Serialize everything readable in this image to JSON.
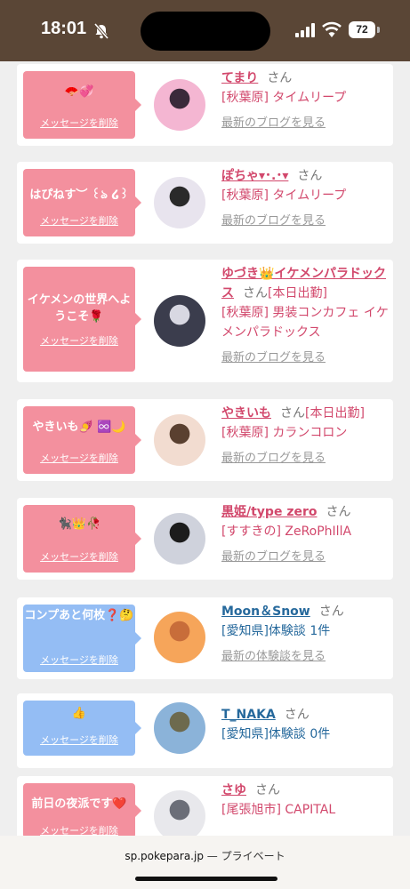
{
  "status_bar": {
    "time": "18:01",
    "battery": "72"
  },
  "cards": [
    {
      "theme": "pink",
      "message": "🪭💞",
      "delete_label": "メッセージを削除",
      "name": "てまり",
      "suffix": "さん",
      "status": "",
      "shop": "[秋葉原] タイムリープ",
      "link": "最新のブログを見る",
      "avatar_colors": [
        "#f4b6d2",
        "#3a2a3a"
      ]
    },
    {
      "theme": "pink",
      "message": "はぴねす︶ ꒰ঌ ໒꒱",
      "delete_label": "メッセージを削除",
      "name": "ぽちゃ▾･.･▾",
      "suffix": "さん",
      "status": "",
      "shop": "[秋葉原] タイムリープ",
      "link": "最新のブログを見る",
      "avatar_colors": [
        "#e8e4ee",
        "#2a2a2a"
      ]
    },
    {
      "theme": "pink",
      "message": "イケメンの世界へようこそ🌹",
      "delete_label": "メッセージを削除",
      "name": "ゆづき👑イケメンパラドックス",
      "suffix": "さん",
      "status": "[本日出勤]",
      "shop": "[秋葉原] 男装コンカフェ イケメンパラドックス",
      "link": "最新のブログを見る",
      "avatar_colors": [
        "#3b3d4d",
        "#d8d8e2"
      ]
    },
    {
      "theme": "pink",
      "message": "やきいも🍠 ♾️🌙",
      "delete_label": "メッセージを削除",
      "name": "やきいも",
      "suffix": "さん",
      "status": "[本日出勤]",
      "shop": "[秋葉原] カランコロン",
      "link": "最新のブログを見る",
      "avatar_colors": [
        "#f2dcd0",
        "#5a4030"
      ]
    },
    {
      "theme": "pink",
      "message": "🐈‍⬛👑🥀",
      "delete_label": "メッセージを削除",
      "name": "黒姫/type zero",
      "suffix": "さん",
      "status": "",
      "shop": "[すすきの] ZeRoPhIllA",
      "link": "最新のブログを見る",
      "avatar_colors": [
        "#cfd2dc",
        "#1c1c1c"
      ]
    },
    {
      "theme": "blue",
      "message": "コンプあと何枚❓🤔",
      "delete_label": "メッセージを削除",
      "name": "Moon＆Snow",
      "suffix": "さん",
      "status": "",
      "shop": "[愛知県]体験談 1件",
      "link": "最新の体験談を見る",
      "avatar_colors": [
        "#f6a55a",
        "#c86d3a"
      ]
    },
    {
      "theme": "blue",
      "message": "👍",
      "delete_label": "メッセージを削除",
      "name": "T_NAKA",
      "suffix": "さん",
      "status": "",
      "shop": "[愛知県]体験談 0件",
      "link": "",
      "avatar_colors": [
        "#8bb3d9",
        "#6d6a4e"
      ]
    },
    {
      "theme": "pink",
      "message": "前日の夜派です❤️",
      "delete_label": "メッセージを削除",
      "name": "さゆ",
      "suffix": "さん",
      "status": "",
      "shop": "[尾張旭市] CAPITAL",
      "link": "",
      "avatar_colors": [
        "#e8e8ec",
        "#6b6e78"
      ]
    }
  ],
  "browser": {
    "domain": "sp.pokepara.jp",
    "mode": "— プライベート"
  }
}
